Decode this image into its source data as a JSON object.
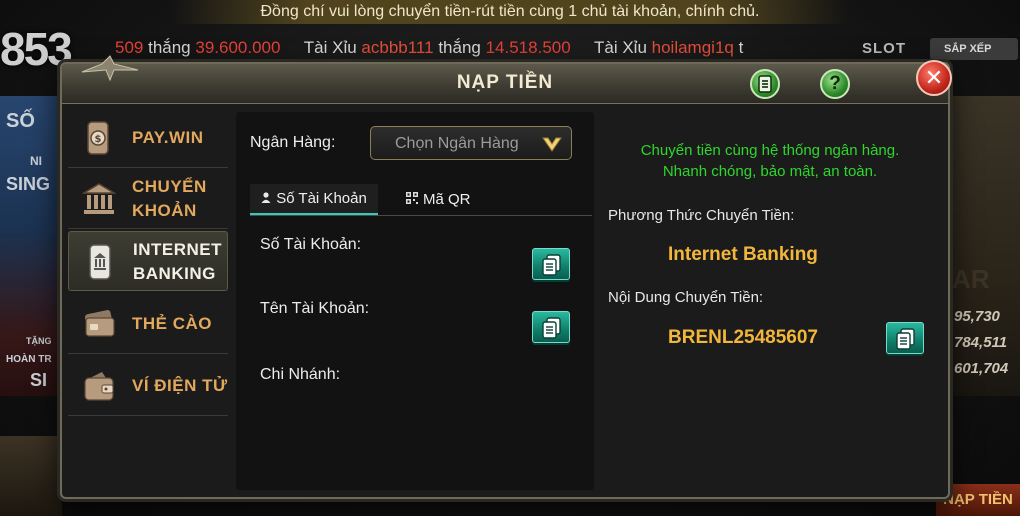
{
  "background": {
    "notice": "Đồng chí vui lòng chuyển tiền-rút tiền cùng 1 chủ tài khoản, chính chủ.",
    "logo": "853",
    "ticker": [
      {
        "num": "509",
        "text": " thắng ",
        "amount": "39.600.000"
      },
      {
        "game": "Tài Xỉu ",
        "user": "acbbb111",
        "text": " thắng ",
        "amount": "14.518.500"
      },
      {
        "game": "Tài Xỉu ",
        "user": "hoilamgi1q",
        "text": " t"
      }
    ],
    "slot_label": "SLOT",
    "sort_label": "SẮP XẾP",
    "left_texts": [
      "SỐ",
      "NI",
      "SING",
      "TẶNG",
      "HOÀN TR",
      "SI"
    ],
    "right_numbers": [
      "95,730",
      "784,511",
      "601,704"
    ],
    "right_tag": "AR",
    "bottom_right": "NẠP TIỀN"
  },
  "dialog": {
    "title": "NẠP TIỀN",
    "list_icon": "list-icon",
    "help_icon": "help-icon",
    "help_glyph": "?",
    "close_glyph": "✕"
  },
  "sidebar": {
    "items": [
      {
        "label": "PAY.WIN",
        "icon": "paywin-icon"
      },
      {
        "label": "CHUYỂN\nKHOẢN",
        "icon": "bank-building-icon"
      },
      {
        "label": "INTERNET\nBANKING",
        "icon": "mobile-bank-icon",
        "active": true
      },
      {
        "label": "THẺ CÀO",
        "icon": "card-icon"
      },
      {
        "label": "VÍ ĐIỆN TỬ",
        "icon": "wallet-icon"
      }
    ]
  },
  "form": {
    "bank_label": "Ngân Hàng:",
    "bank_placeholder": "Chọn Ngân Hàng",
    "tabs": [
      {
        "label": "Số Tài Khoản",
        "icon": "user-icon",
        "active": true
      },
      {
        "label": "Mã QR",
        "icon": "qr-icon"
      }
    ],
    "account_number_label": "Số Tài Khoản:",
    "account_name_label": "Tên Tài Khoản:",
    "branch_label": "Chi Nhánh:"
  },
  "info": {
    "message_line1": "Chuyển tiền cùng hệ thống ngân hàng.",
    "message_line2": "Nhanh chóng, bảo mật, an toàn.",
    "method_label": "Phương Thức Chuyển Tiền:",
    "method_value": "Internet Banking",
    "content_label": "Nội Dung Chuyển Tiền:",
    "content_value": "BRENL25485607",
    "colors": {
      "message": "#2fd72c",
      "value": "#f2b73a",
      "copy_button": "#16927c"
    }
  }
}
